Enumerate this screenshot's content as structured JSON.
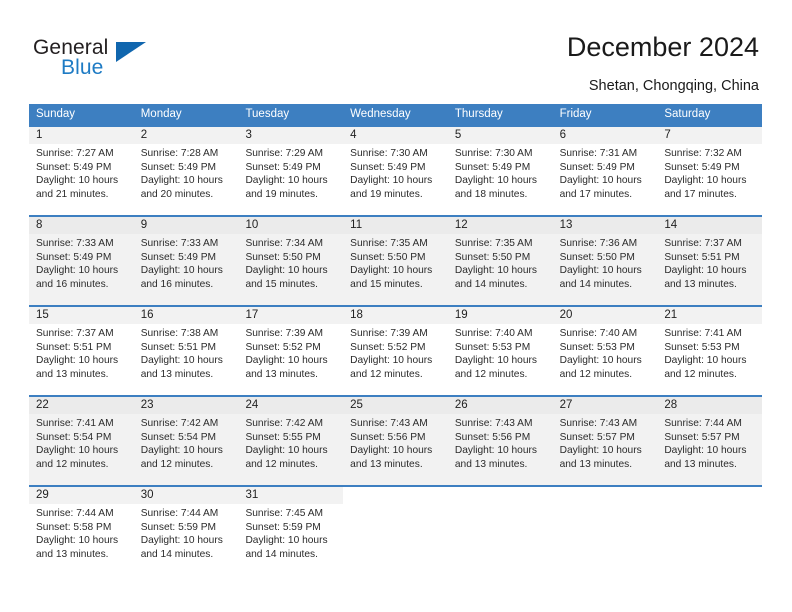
{
  "brand": {
    "name_part1": "General",
    "name_part2": "Blue",
    "accent_color": "#1066ae",
    "text_color": "#231f20"
  },
  "header": {
    "title": "December 2024",
    "location": "Shetan, Chongqing, China"
  },
  "calendar": {
    "header_color": "#3d7fc1",
    "band_color": "#f2f2f2",
    "weekdays": [
      "Sunday",
      "Monday",
      "Tuesday",
      "Wednesday",
      "Thursday",
      "Friday",
      "Saturday"
    ],
    "weeks": [
      [
        {
          "day": "1",
          "sunrise": "Sunrise: 7:27 AM",
          "sunset": "Sunset: 5:49 PM",
          "daylight1": "Daylight: 10 hours",
          "daylight2": "and 21 minutes."
        },
        {
          "day": "2",
          "sunrise": "Sunrise: 7:28 AM",
          "sunset": "Sunset: 5:49 PM",
          "daylight1": "Daylight: 10 hours",
          "daylight2": "and 20 minutes."
        },
        {
          "day": "3",
          "sunrise": "Sunrise: 7:29 AM",
          "sunset": "Sunset: 5:49 PM",
          "daylight1": "Daylight: 10 hours",
          "daylight2": "and 19 minutes."
        },
        {
          "day": "4",
          "sunrise": "Sunrise: 7:30 AM",
          "sunset": "Sunset: 5:49 PM",
          "daylight1": "Daylight: 10 hours",
          "daylight2": "and 19 minutes."
        },
        {
          "day": "5",
          "sunrise": "Sunrise: 7:30 AM",
          "sunset": "Sunset: 5:49 PM",
          "daylight1": "Daylight: 10 hours",
          "daylight2": "and 18 minutes."
        },
        {
          "day": "6",
          "sunrise": "Sunrise: 7:31 AM",
          "sunset": "Sunset: 5:49 PM",
          "daylight1": "Daylight: 10 hours",
          "daylight2": "and 17 minutes."
        },
        {
          "day": "7",
          "sunrise": "Sunrise: 7:32 AM",
          "sunset": "Sunset: 5:49 PM",
          "daylight1": "Daylight: 10 hours",
          "daylight2": "and 17 minutes."
        }
      ],
      [
        {
          "day": "8",
          "sunrise": "Sunrise: 7:33 AM",
          "sunset": "Sunset: 5:49 PM",
          "daylight1": "Daylight: 10 hours",
          "daylight2": "and 16 minutes."
        },
        {
          "day": "9",
          "sunrise": "Sunrise: 7:33 AM",
          "sunset": "Sunset: 5:49 PM",
          "daylight1": "Daylight: 10 hours",
          "daylight2": "and 16 minutes."
        },
        {
          "day": "10",
          "sunrise": "Sunrise: 7:34 AM",
          "sunset": "Sunset: 5:50 PM",
          "daylight1": "Daylight: 10 hours",
          "daylight2": "and 15 minutes."
        },
        {
          "day": "11",
          "sunrise": "Sunrise: 7:35 AM",
          "sunset": "Sunset: 5:50 PM",
          "daylight1": "Daylight: 10 hours",
          "daylight2": "and 15 minutes."
        },
        {
          "day": "12",
          "sunrise": "Sunrise: 7:35 AM",
          "sunset": "Sunset: 5:50 PM",
          "daylight1": "Daylight: 10 hours",
          "daylight2": "and 14 minutes."
        },
        {
          "day": "13",
          "sunrise": "Sunrise: 7:36 AM",
          "sunset": "Sunset: 5:50 PM",
          "daylight1": "Daylight: 10 hours",
          "daylight2": "and 14 minutes."
        },
        {
          "day": "14",
          "sunrise": "Sunrise: 7:37 AM",
          "sunset": "Sunset: 5:51 PM",
          "daylight1": "Daylight: 10 hours",
          "daylight2": "and 13 minutes."
        }
      ],
      [
        {
          "day": "15",
          "sunrise": "Sunrise: 7:37 AM",
          "sunset": "Sunset: 5:51 PM",
          "daylight1": "Daylight: 10 hours",
          "daylight2": "and 13 minutes."
        },
        {
          "day": "16",
          "sunrise": "Sunrise: 7:38 AM",
          "sunset": "Sunset: 5:51 PM",
          "daylight1": "Daylight: 10 hours",
          "daylight2": "and 13 minutes."
        },
        {
          "day": "17",
          "sunrise": "Sunrise: 7:39 AM",
          "sunset": "Sunset: 5:52 PM",
          "daylight1": "Daylight: 10 hours",
          "daylight2": "and 13 minutes."
        },
        {
          "day": "18",
          "sunrise": "Sunrise: 7:39 AM",
          "sunset": "Sunset: 5:52 PM",
          "daylight1": "Daylight: 10 hours",
          "daylight2": "and 12 minutes."
        },
        {
          "day": "19",
          "sunrise": "Sunrise: 7:40 AM",
          "sunset": "Sunset: 5:53 PM",
          "daylight1": "Daylight: 10 hours",
          "daylight2": "and 12 minutes."
        },
        {
          "day": "20",
          "sunrise": "Sunrise: 7:40 AM",
          "sunset": "Sunset: 5:53 PM",
          "daylight1": "Daylight: 10 hours",
          "daylight2": "and 12 minutes."
        },
        {
          "day": "21",
          "sunrise": "Sunrise: 7:41 AM",
          "sunset": "Sunset: 5:53 PM",
          "daylight1": "Daylight: 10 hours",
          "daylight2": "and 12 minutes."
        }
      ],
      [
        {
          "day": "22",
          "sunrise": "Sunrise: 7:41 AM",
          "sunset": "Sunset: 5:54 PM",
          "daylight1": "Daylight: 10 hours",
          "daylight2": "and 12 minutes."
        },
        {
          "day": "23",
          "sunrise": "Sunrise: 7:42 AM",
          "sunset": "Sunset: 5:54 PM",
          "daylight1": "Daylight: 10 hours",
          "daylight2": "and 12 minutes."
        },
        {
          "day": "24",
          "sunrise": "Sunrise: 7:42 AM",
          "sunset": "Sunset: 5:55 PM",
          "daylight1": "Daylight: 10 hours",
          "daylight2": "and 12 minutes."
        },
        {
          "day": "25",
          "sunrise": "Sunrise: 7:43 AM",
          "sunset": "Sunset: 5:56 PM",
          "daylight1": "Daylight: 10 hours",
          "daylight2": "and 13 minutes."
        },
        {
          "day": "26",
          "sunrise": "Sunrise: 7:43 AM",
          "sunset": "Sunset: 5:56 PM",
          "daylight1": "Daylight: 10 hours",
          "daylight2": "and 13 minutes."
        },
        {
          "day": "27",
          "sunrise": "Sunrise: 7:43 AM",
          "sunset": "Sunset: 5:57 PM",
          "daylight1": "Daylight: 10 hours",
          "daylight2": "and 13 minutes."
        },
        {
          "day": "28",
          "sunrise": "Sunrise: 7:44 AM",
          "sunset": "Sunset: 5:57 PM",
          "daylight1": "Daylight: 10 hours",
          "daylight2": "and 13 minutes."
        }
      ],
      [
        {
          "day": "29",
          "sunrise": "Sunrise: 7:44 AM",
          "sunset": "Sunset: 5:58 PM",
          "daylight1": "Daylight: 10 hours",
          "daylight2": "and 13 minutes."
        },
        {
          "day": "30",
          "sunrise": "Sunrise: 7:44 AM",
          "sunset": "Sunset: 5:59 PM",
          "daylight1": "Daylight: 10 hours",
          "daylight2": "and 14 minutes."
        },
        {
          "day": "31",
          "sunrise": "Sunrise: 7:45 AM",
          "sunset": "Sunset: 5:59 PM",
          "daylight1": "Daylight: 10 hours",
          "daylight2": "and 14 minutes."
        },
        {
          "day": "",
          "sunrise": "",
          "sunset": "",
          "daylight1": "",
          "daylight2": ""
        },
        {
          "day": "",
          "sunrise": "",
          "sunset": "",
          "daylight1": "",
          "daylight2": ""
        },
        {
          "day": "",
          "sunrise": "",
          "sunset": "",
          "daylight1": "",
          "daylight2": ""
        },
        {
          "day": "",
          "sunrise": "",
          "sunset": "",
          "daylight1": "",
          "daylight2": ""
        }
      ]
    ]
  }
}
